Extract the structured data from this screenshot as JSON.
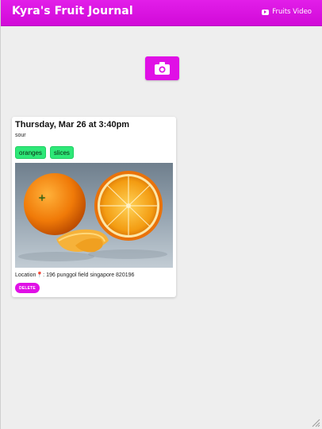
{
  "header": {
    "title": "Kyra's Fruit Journal",
    "video_link_label": "Fruits Video",
    "video_icon": "youtube-icon",
    "background": "#d10ad8"
  },
  "toolbar": {
    "camera_icon": "camera-icon",
    "camera_button_color": "#e010e6"
  },
  "entries": [
    {
      "date": "Thursday, Mar 26 at 3:40pm",
      "taste": "sour",
      "tags": [
        "oranges",
        "slices"
      ],
      "tag_color": "#2ee878",
      "location": "Location📍: 196 punggol field singapore 820196",
      "delete_label": "DELETE"
    }
  ]
}
